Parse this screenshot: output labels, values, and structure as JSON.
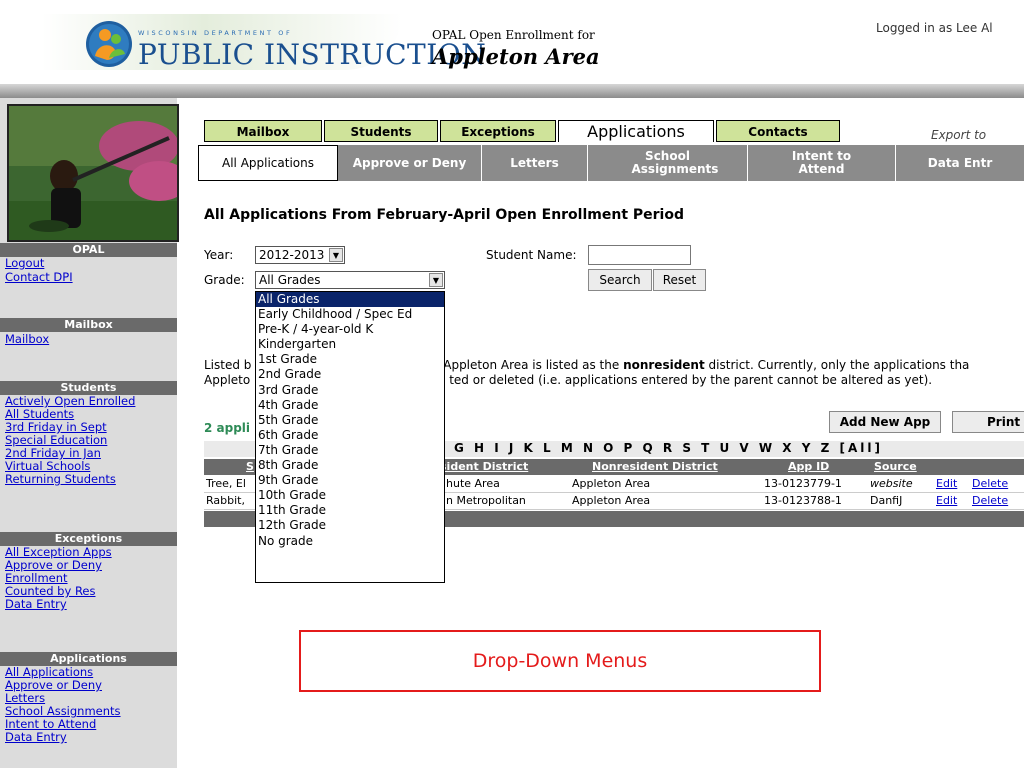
{
  "header": {
    "agency_top": "WISCONSIN DEPARTMENT OF",
    "agency_name": "PUBLIC INSTRUCTION",
    "opal_line": "OPAL Open Enrollment for",
    "district": "Appleton Area",
    "login": "Logged in as Lee Al"
  },
  "sidebar": {
    "opal_head": "OPAL",
    "opal_links": [
      "Logout",
      "Contact DPI"
    ],
    "mailbox_head": "Mailbox",
    "mailbox_links": [
      "Mailbox"
    ],
    "students_head": "Students",
    "students_links": [
      "Actively Open Enrolled",
      "All Students",
      "3rd Friday in Sept",
      "Special Education",
      "2nd Friday in Jan",
      "Virtual Schools",
      "Returning Students"
    ],
    "exceptions_head": "Exceptions",
    "exceptions_links": [
      "All Exception Apps",
      "Approve or Deny",
      "Enrollment",
      "Counted by Res",
      "Data Entry"
    ],
    "applications_head": "Applications",
    "applications_links": [
      "All Applications",
      "Approve or Deny",
      "Letters",
      "School Assignments",
      "Intent to Attend",
      "Data Entry"
    ]
  },
  "tabs": {
    "top": [
      "Mailbox",
      "Students",
      "Exceptions",
      "Applications",
      "Contacts"
    ],
    "active_top": "Applications",
    "export": "Export to",
    "sub": [
      "All Applications",
      "Approve or Deny",
      "Letters",
      "School Assignments",
      "Intent to Attend",
      "Data Entr"
    ]
  },
  "page": {
    "title": "All Applications From February-April Open Enrollment Period",
    "year_label": "Year:",
    "year_value": "2012-2013",
    "grade_label": "Grade:",
    "grade_value": "All Grades",
    "student_name_label": "Student Name:",
    "student_name_value": "",
    "search_button": "Search",
    "reset_button": "Reset",
    "grade_options": [
      "All Grades",
      "Early Childhood / Spec Ed",
      "Pre-K / 4-year-old K",
      "Kindergarten",
      "1st Grade",
      "2nd Grade",
      "3rd Grade",
      "4th Grade",
      "5th Grade",
      "6th Grade",
      "7th Grade",
      "8th Grade",
      "9th Grade",
      "10th Grade",
      "11th Grade",
      "12th Grade",
      "No grade"
    ],
    "para_line1_a": "Listed b",
    "para_line1_b": " Appleton Area is listed as the ",
    "para_line1_bold": "nonresident",
    "para_line1_c": " district. Currently, only the applications tha",
    "para_line2_a": "Appleto",
    "para_line2_b": "ted or deleted (i.e. applications entered by the parent cannot be altered as yet).",
    "app_count": "2 appli",
    "add_new_button": "Add New App",
    "print_button": "Print",
    "alpha": "G H I J K L M N O P Q R S T U V W X Y Z [All]"
  },
  "table": {
    "headers": [
      "S",
      "sident District",
      "Nonresident District",
      "App ID",
      "Source"
    ],
    "rows": [
      {
        "student": "Tree, El",
        "resident": "hute Area",
        "nonresident": "Appleton Area",
        "app_id": "13-0123779-1",
        "source": "website",
        "edit": "Edit",
        "delete": "Delete"
      },
      {
        "student": "Rabbit,",
        "resident": "n Metropolitan",
        "nonresident": "Appleton Area",
        "app_id": "13-0123788-1",
        "source": "DanfiJ",
        "edit": "Edit",
        "delete": "Delete"
      }
    ]
  },
  "callout": "Drop-Down Menus",
  "colors": {
    "tab_green": "#cfe39a",
    "sidebar_gray": "#dcdcdc",
    "section_gray": "#6a6a6a",
    "highlight_blue": "#0a246a",
    "callout_red": "#e41b1b"
  }
}
